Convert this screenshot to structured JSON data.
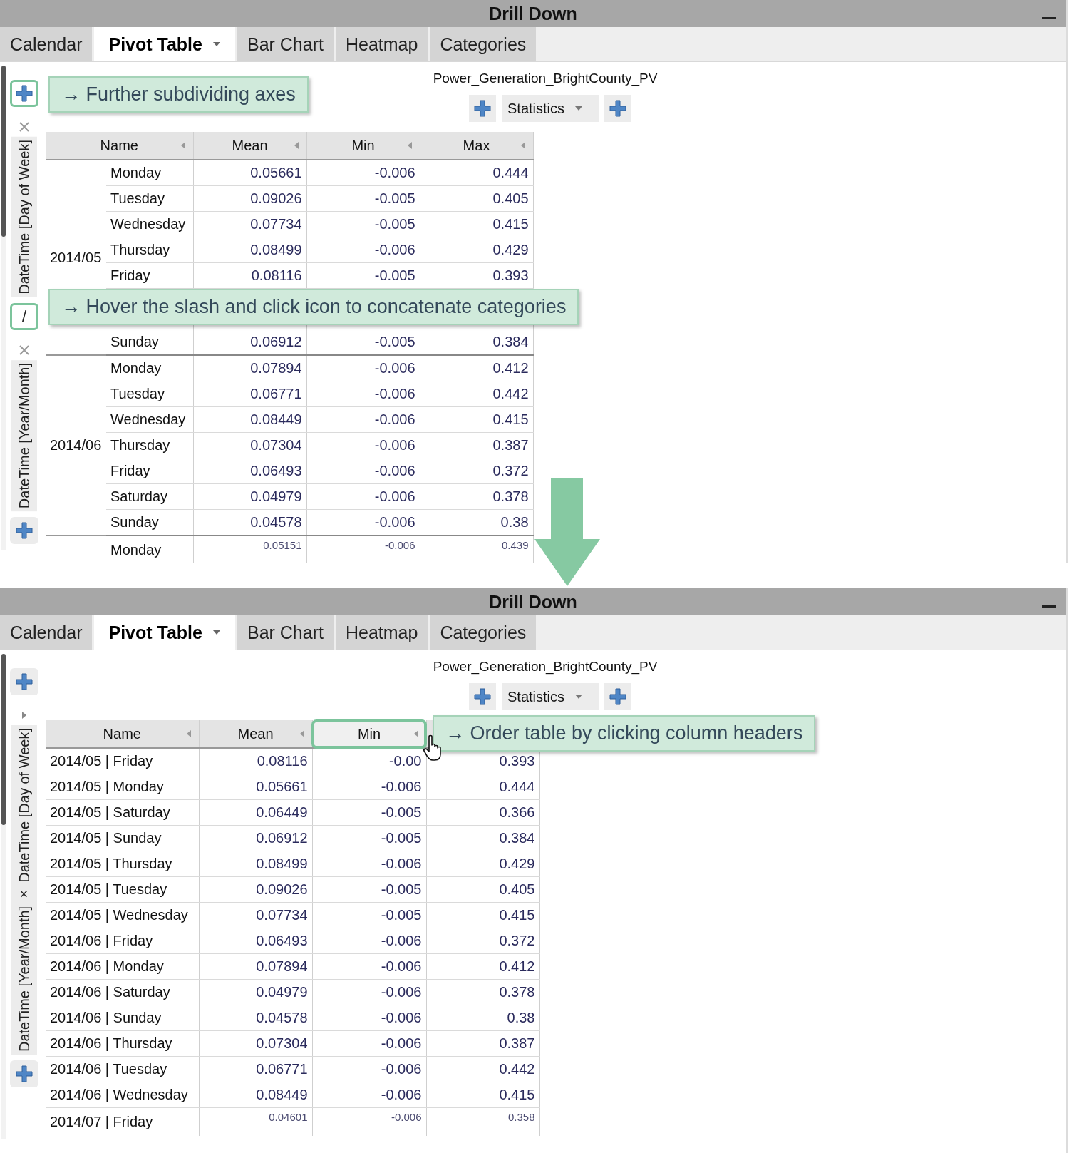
{
  "panels": [
    {
      "title": "Drill Down",
      "tabs": [
        {
          "label": "Calendar",
          "selected": false,
          "menu": false
        },
        {
          "label": "Pivot Table",
          "selected": true,
          "menu": true
        },
        {
          "label": "Bar Chart",
          "selected": false,
          "menu": false
        },
        {
          "label": "Heatmap",
          "selected": false,
          "menu": false
        },
        {
          "label": "Categories",
          "selected": false,
          "menu": false
        }
      ],
      "dataset": "Power_Generation_BrightCounty_PV",
      "statistics": "Statistics",
      "axis": [
        {
          "kind": "add",
          "highlighted": true
        },
        {
          "kind": "remove"
        },
        {
          "kind": "label",
          "text": "DateTime [Day of Week]"
        },
        {
          "kind": "join",
          "text": "/",
          "highlighted": true
        },
        {
          "kind": "remove"
        },
        {
          "kind": "label",
          "text": "DateTime [Year/Month]"
        },
        {
          "kind": "add",
          "highlighted": false
        }
      ],
      "columns": [
        {
          "label": "Name",
          "highlighted": false,
          "hovered": false
        },
        {
          "label": "Mean",
          "highlighted": false,
          "hovered": false
        },
        {
          "label": "Min",
          "highlighted": false,
          "hovered": false
        },
        {
          "label": "Max",
          "highlighted": false,
          "hovered": false
        }
      ],
      "groups": [
        {
          "label": "2014/05",
          "rows": [
            {
              "name": "Monday",
              "mean": "0.05661",
              "min": "-0.006",
              "max": "0.444",
              "partial": false
            },
            {
              "name": "Tuesday",
              "mean": "0.09026",
              "min": "-0.005",
              "max": "0.405",
              "partial": false
            },
            {
              "name": "Wednesday",
              "mean": "0.07734",
              "min": "-0.005",
              "max": "0.415",
              "partial": false
            },
            {
              "name": "Thursday",
              "mean": "0.08499",
              "min": "-0.006",
              "max": "0.429",
              "partial": false
            },
            {
              "name": "Friday",
              "mean": "0.08116",
              "min": "-0.005",
              "max": "0.393",
              "partial": false
            },
            {
              "name": "Sunday",
              "mean": "0.06912",
              "min": "-0.005",
              "max": "0.384",
              "partial": false
            }
          ]
        },
        {
          "label": "2014/06",
          "rows": [
            {
              "name": "Monday",
              "mean": "0.07894",
              "min": "-0.006",
              "max": "0.412",
              "partial": false
            },
            {
              "name": "Tuesday",
              "mean": "0.06771",
              "min": "-0.006",
              "max": "0.442",
              "partial": false
            },
            {
              "name": "Wednesday",
              "mean": "0.08449",
              "min": "-0.006",
              "max": "0.415",
              "partial": false
            },
            {
              "name": "Thursday",
              "mean": "0.07304",
              "min": "-0.006",
              "max": "0.387",
              "partial": false
            },
            {
              "name": "Friday",
              "mean": "0.06493",
              "min": "-0.006",
              "max": "0.372",
              "partial": false
            },
            {
              "name": "Saturday",
              "mean": "0.04979",
              "min": "-0.006",
              "max": "0.378",
              "partial": false
            },
            {
              "name": "Sunday",
              "mean": "0.04578",
              "min": "-0.006",
              "max": "0.38",
              "partial": false
            }
          ]
        },
        {
          "rows": [
            {
              "name": "Monday",
              "mean": "0.05151",
              "min": "-0.006",
              "max": "0.439",
              "partial": true
            }
          ]
        }
      ],
      "callouts": [
        "→ Further subdividing axes",
        "→ Hover the slash and click icon to concatenate categories"
      ]
    },
    {
      "title": "Drill Down",
      "tabs": [
        {
          "label": "Calendar",
          "selected": false,
          "menu": false
        },
        {
          "label": "Pivot Table",
          "selected": true,
          "menu": true
        },
        {
          "label": "Bar Chart",
          "selected": false,
          "menu": false
        },
        {
          "label": "Heatmap",
          "selected": false,
          "menu": false
        },
        {
          "label": "Categories",
          "selected": false,
          "menu": false
        }
      ],
      "dataset": "Power_Generation_BrightCounty_PV",
      "statistics": "Statistics",
      "axis": [
        {
          "kind": "add",
          "highlighted": false
        },
        {
          "kind": "expand"
        },
        {
          "kind": "label",
          "text": "DateTime [Year/Month] × DateTime [Day of Week]"
        },
        {
          "kind": "add",
          "highlighted": false
        }
      ],
      "columns": [
        {
          "label": "Name",
          "highlighted": false,
          "hovered": false
        },
        {
          "label": "Mean",
          "highlighted": false,
          "hovered": false
        },
        {
          "label": "Min",
          "highlighted": true,
          "hovered": true
        }
      ],
      "rows": [
        {
          "name": "2014/05 | Friday",
          "mean": "0.08116",
          "min": "-0.00",
          "max": "0.393",
          "partial": false
        },
        {
          "name": "2014/05 | Monday",
          "mean": "0.05661",
          "min": "-0.006",
          "max": "0.444",
          "partial": false
        },
        {
          "name": "2014/05 | Saturday",
          "mean": "0.06449",
          "min": "-0.005",
          "max": "0.366",
          "partial": false
        },
        {
          "name": "2014/05 | Sunday",
          "mean": "0.06912",
          "min": "-0.005",
          "max": "0.384",
          "partial": false
        },
        {
          "name": "2014/05 | Thursday",
          "mean": "0.08499",
          "min": "-0.006",
          "max": "0.429",
          "partial": false
        },
        {
          "name": "2014/05 | Tuesday",
          "mean": "0.09026",
          "min": "-0.005",
          "max": "0.405",
          "partial": false
        },
        {
          "name": "2014/05 | Wednesday",
          "mean": "0.07734",
          "min": "-0.005",
          "max": "0.415",
          "partial": false
        },
        {
          "name": "2014/06 | Friday",
          "mean": "0.06493",
          "min": "-0.006",
          "max": "0.372",
          "partial": false
        },
        {
          "name": "2014/06 | Monday",
          "mean": "0.07894",
          "min": "-0.006",
          "max": "0.412",
          "partial": false
        },
        {
          "name": "2014/06 | Saturday",
          "mean": "0.04979",
          "min": "-0.006",
          "max": "0.378",
          "partial": false
        },
        {
          "name": "2014/06 | Sunday",
          "mean": "0.04578",
          "min": "-0.006",
          "max": "0.38",
          "partial": false
        },
        {
          "name": "2014/06 | Thursday",
          "mean": "0.07304",
          "min": "-0.006",
          "max": "0.387",
          "partial": false
        },
        {
          "name": "2014/06 | Tuesday",
          "mean": "0.06771",
          "min": "-0.006",
          "max": "0.442",
          "partial": false
        },
        {
          "name": "2014/06 | Wednesday",
          "mean": "0.08449",
          "min": "-0.006",
          "max": "0.415",
          "partial": false
        },
        {
          "name": "2014/07 | Friday",
          "mean": "0.04601",
          "min": "-0.006",
          "max": "0.358",
          "partial": true
        }
      ],
      "callouts": [
        "→ Order table by clicking column headers"
      ]
    }
  ]
}
